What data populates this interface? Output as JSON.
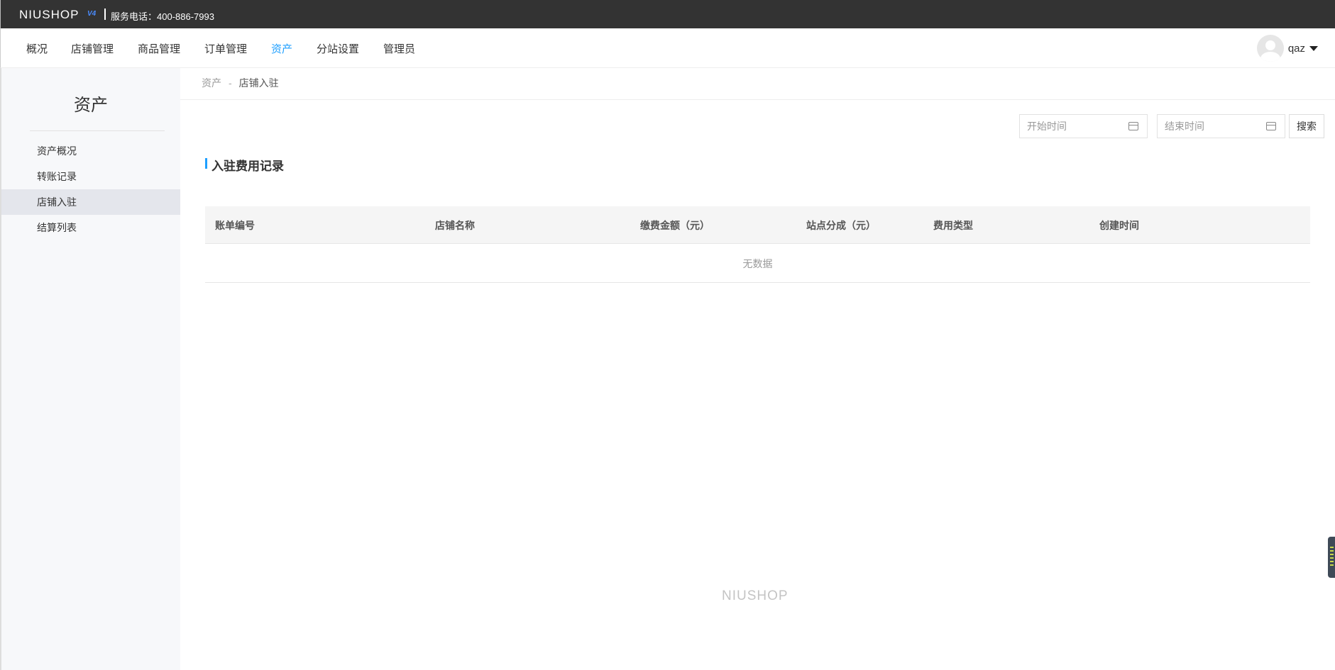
{
  "topbar": {
    "logo": "NIUSHOP",
    "logo_version": "V4",
    "hotline": "服务电话：400-886-7993"
  },
  "nav": {
    "items": [
      {
        "label": "概况"
      },
      {
        "label": "店铺管理"
      },
      {
        "label": "商品管理"
      },
      {
        "label": "订单管理"
      },
      {
        "label": "资产",
        "active": true
      },
      {
        "label": "分站设置"
      },
      {
        "label": "管理员"
      }
    ],
    "username": "qaz"
  },
  "sidebar": {
    "title": "资产",
    "items": [
      {
        "label": "资产概况"
      },
      {
        "label": "转账记录"
      },
      {
        "label": "店铺入驻",
        "active": true
      },
      {
        "label": "结算列表"
      }
    ]
  },
  "breadcrumb": {
    "parent": "资产",
    "separator": "-",
    "current": "店铺入驻"
  },
  "filters": {
    "start_placeholder": "开始时间",
    "end_placeholder": "结束时间",
    "search_label": "搜索"
  },
  "section": {
    "title": "入驻费用记录"
  },
  "table": {
    "columns": [
      "账单编号",
      "店铺名称",
      "缴费金额（元）",
      "站点分成（元）",
      "费用类型",
      "创建时间"
    ],
    "rows": [],
    "empty_text": "无数据"
  },
  "footer": {
    "logo": "NIUSHOP"
  },
  "colors": {
    "accent": "#1e9fff",
    "topbar_bg": "#333333",
    "sidebar_bg": "#f7f8fa",
    "sidebar_active_bg": "#e4e6ec"
  }
}
